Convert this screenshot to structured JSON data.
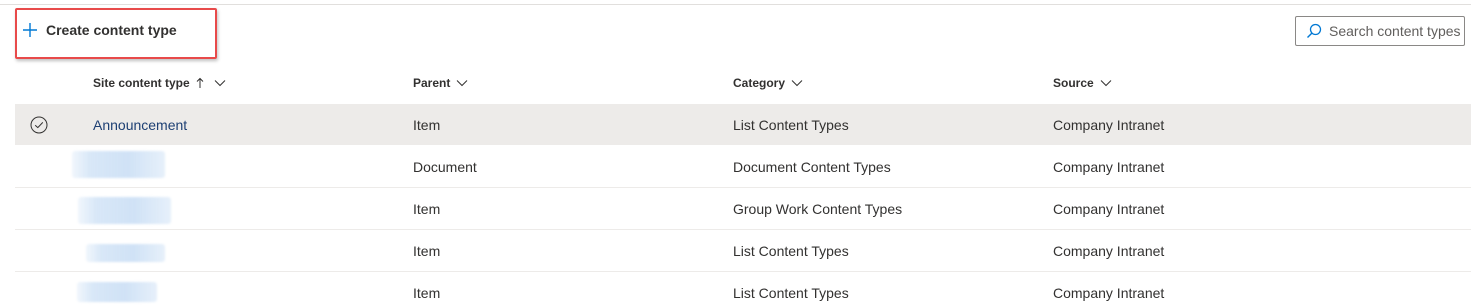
{
  "command_bar": {
    "create_label": "Create content type",
    "search_placeholder": "Search content types"
  },
  "columns": [
    {
      "label": "Site content type",
      "sorted": "ascending"
    },
    {
      "label": "Parent"
    },
    {
      "label": "Category"
    },
    {
      "label": "Source"
    }
  ],
  "rows": [
    {
      "name": "Announcement",
      "parent": "Item",
      "category": "List Content Types",
      "source": "Company Intranet",
      "selected": true,
      "name_redacted": false
    },
    {
      "name": "",
      "parent": "Document",
      "category": "Document Content Types",
      "source": "Company Intranet",
      "selected": false,
      "name_redacted": true
    },
    {
      "name": "",
      "parent": "Item",
      "category": "Group Work Content Types",
      "source": "Company Intranet",
      "selected": false,
      "name_redacted": true
    },
    {
      "name": "",
      "parent": "Item",
      "category": "List Content Types",
      "source": "Company Intranet",
      "selected": false,
      "name_redacted": true
    },
    {
      "name": "",
      "parent": "Item",
      "category": "List Content Types",
      "source": "Company Intranet",
      "selected": false,
      "name_redacted": true
    }
  ],
  "colors": {
    "accent": "#0078d4",
    "highlight_border": "#e84a4a",
    "link": "#1d3f73",
    "selected_row": "#edebe9"
  },
  "icons": {
    "create": "plus-icon",
    "search": "search-icon",
    "sort": "sort-arrow-up-icon",
    "column_menu": "chevron-down-icon",
    "row_select": "check-circle-icon"
  }
}
